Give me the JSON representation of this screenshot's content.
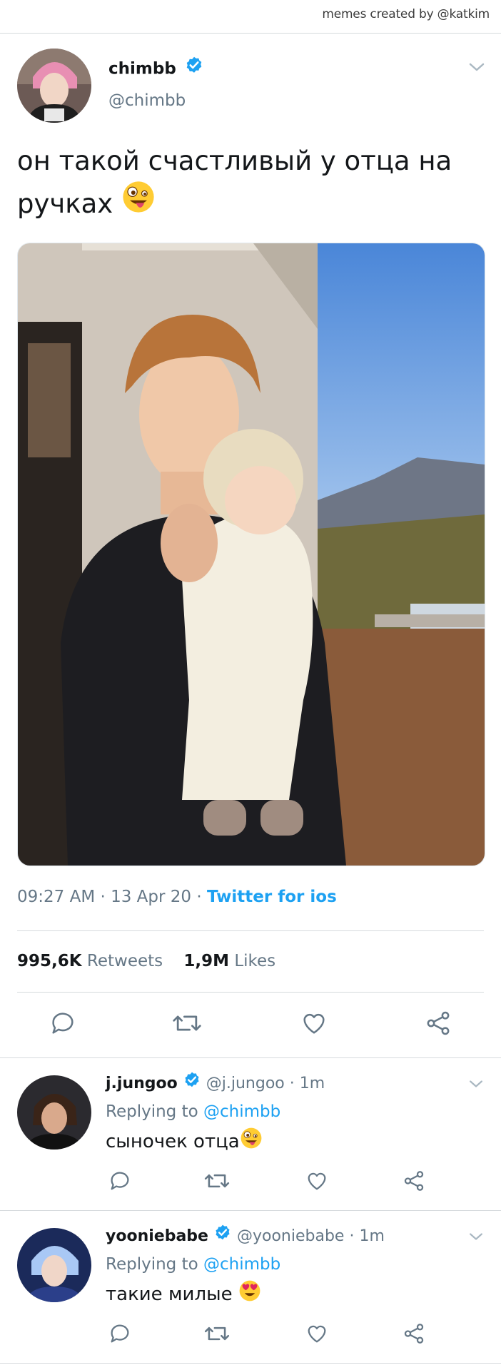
{
  "watermark": "memes created by @katkim",
  "tweet": {
    "name": "chimbb",
    "handle": "@chimbb",
    "text": "он такой счастливый у отца на ручках",
    "time": "09:27 AM",
    "date": "13 Apr 20",
    "source": "Twitter for ios",
    "retweets": "995,6K",
    "retweets_label": "Retweets",
    "likes": "1,9M",
    "likes_label": "Likes"
  },
  "replies": [
    {
      "name": "j.jungoo",
      "handle": "@j.jungoo",
      "time": "1m",
      "replying_label": "Replying to",
      "replying_to": "@chimbb",
      "text": "сыночек отца"
    },
    {
      "name": "yooniebabe",
      "handle": "@yooniebabe",
      "time": "1m",
      "replying_label": "Replying to",
      "replying_to": "@chimbb",
      "text": "такие милые"
    }
  ],
  "icons": [
    "verified-icon",
    "chevron-down-icon",
    "reply-icon",
    "retweet-icon",
    "like-icon",
    "share-icon",
    "zany-face-emoji",
    "heart-eyes-emoji"
  ],
  "colors": {
    "accent": "#1da1f2",
    "muted": "#657786",
    "text": "#14171a",
    "divider": "#d6dadd"
  }
}
